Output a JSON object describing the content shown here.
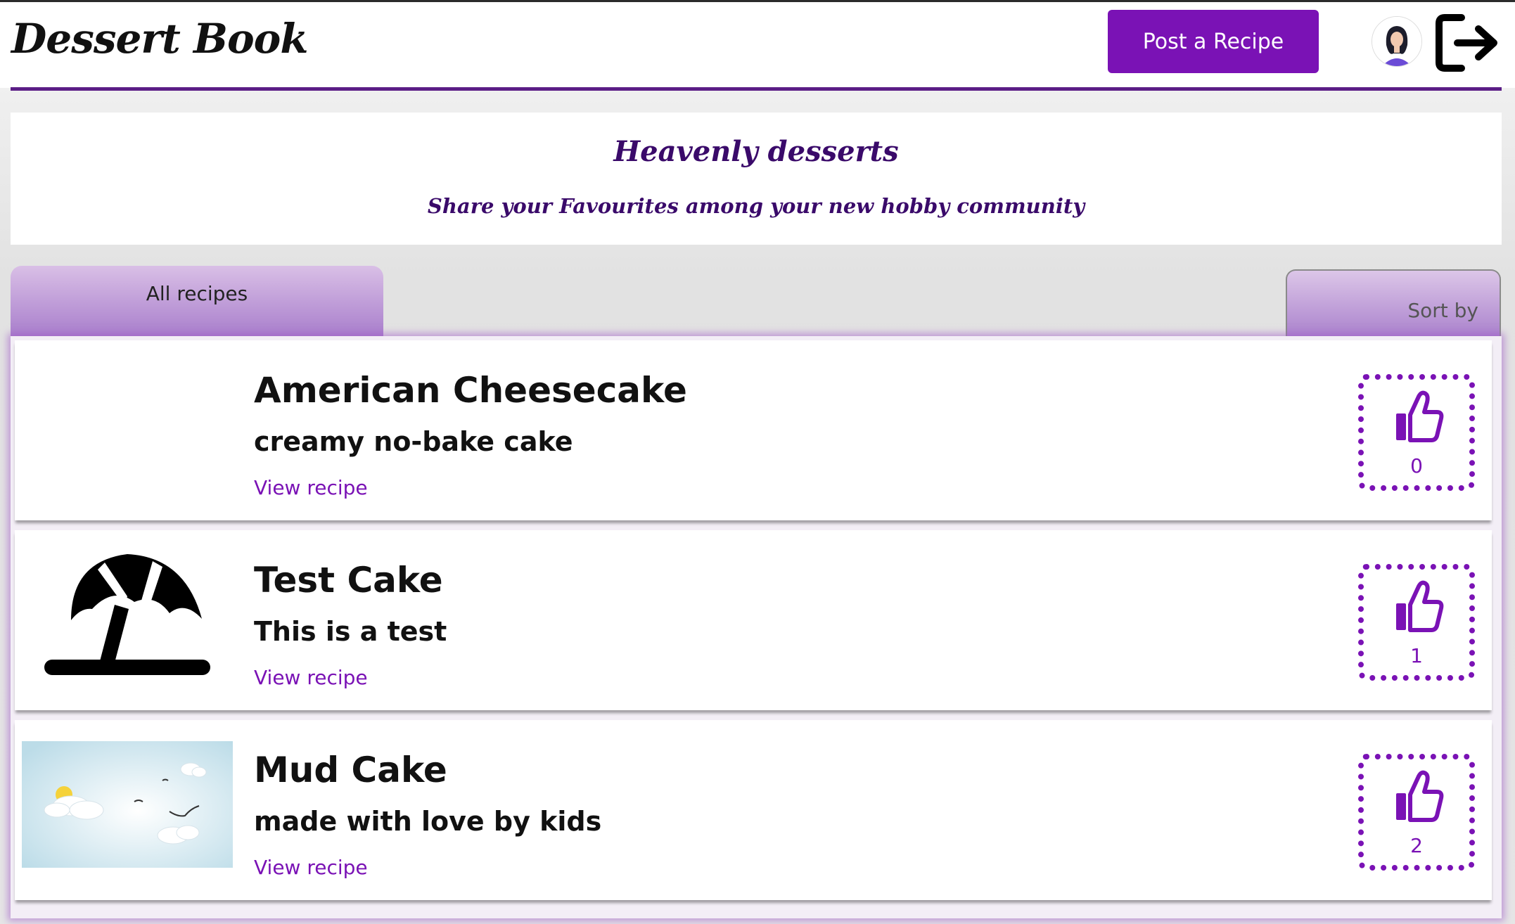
{
  "header": {
    "brand": "Dessert Book",
    "post_button": "Post a Recipe"
  },
  "hero": {
    "title": "Heavenly desserts",
    "subtitle": "Share your Favourites among your new hobby community"
  },
  "tabs": {
    "all": "All recipes",
    "sort": "Sort by"
  },
  "recipes": [
    {
      "title": "American Cheesecake",
      "subtitle": "creamy no-bake cake",
      "link": "View recipe",
      "likes": "0",
      "image": "none"
    },
    {
      "title": "Test Cake",
      "subtitle": "This is a test",
      "link": "View recipe",
      "likes": "1",
      "image": "beach-umbrella-icon"
    },
    {
      "title": "Mud Cake",
      "subtitle": "made with love by kids",
      "link": "View recipe",
      "likes": "2",
      "image": "sky-clouds-birds"
    }
  ],
  "colors": {
    "accent": "#7a12b5",
    "hero_text": "#3a0a6a",
    "rule": "#5b1e86"
  }
}
